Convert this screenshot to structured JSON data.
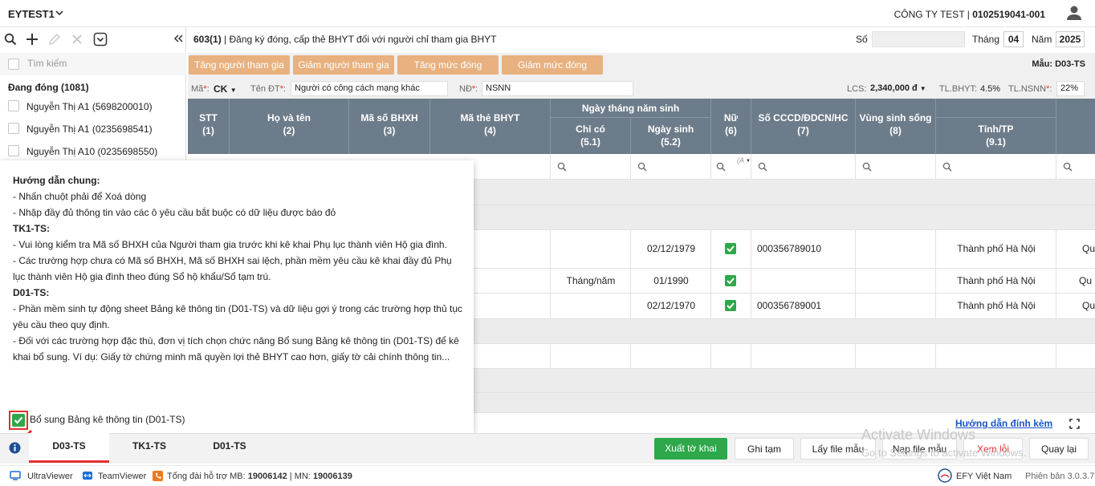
{
  "topbar": {
    "app_title": "EYTEST1",
    "company_name": "CÔNG TY TEST",
    "tax_code": "0102519041-001"
  },
  "sidebar": {
    "search_placeholder": "Tìm kiếm",
    "group_title": "Đang đóng (1081)",
    "items": [
      {
        "label": "Nguyễn Thị A1 (5698200010)"
      },
      {
        "label": "Nguyễn Thị A1 (0235698541)"
      },
      {
        "label": "Nguyễn Thị A10 (0235698550)"
      }
    ]
  },
  "header": {
    "form_code": "603(1)",
    "form_title": " | Đăng ký đóng, cấp thẻ BHYT đối với người chỉ tham gia BHYT",
    "so_label": "Số",
    "so_value": "",
    "thang_label": "Tháng",
    "thang_value": "04",
    "nam_label": "Năm",
    "nam_value": "2025"
  },
  "actions": {
    "buttons": [
      "Tăng người tham gia",
      "Giảm người tham gia",
      "Tăng mức đóng",
      "Giảm mức đóng"
    ],
    "mau": "Mẫu: D03-TS"
  },
  "fields": {
    "ma_label": "Mã",
    "ma_value": "CK",
    "tendt_label": "Tên ĐT",
    "tendt_value": "Người có công cách mạng khác",
    "nd_label": "NĐ",
    "nd_value": "NSNN",
    "lcs_label": "LCS:",
    "lcs_value": "2,340,000 đ",
    "tlbhyt_label": "TL.BHYT:",
    "tlbhyt_value": "4.5%",
    "tlnsnn_label": "TL.NSNN",
    "tlnsnn_value": "22%"
  },
  "table": {
    "group_header": "Ngày tháng năm sinh",
    "columns": [
      {
        "label": "STT",
        "num": "(1)"
      },
      {
        "label": "Họ và tên",
        "num": "(2)"
      },
      {
        "label": "Mã số BHXH",
        "num": "(3)"
      },
      {
        "label": "Mã thẻ BHYT",
        "num": "(4)"
      },
      {
        "label": "Chỉ có",
        "num": "(5.1)"
      },
      {
        "label": "Ngày sinh",
        "num": "(5.2)"
      },
      {
        "label": "Nữ",
        "num": "(6)"
      },
      {
        "label": "Số CCCD/ĐDCN/HC",
        "num": "(7)"
      },
      {
        "label": "Vùng sinh sống",
        "num": "(8)"
      },
      {
        "label": "Tỉnh/TP",
        "num": "(9.1)"
      }
    ],
    "filter_hint": "(A",
    "rows": [
      {
        "chi_co": "",
        "ngay_sinh": "02/12/1979",
        "nu": true,
        "cccd": "000356789010",
        "tinh": "Thành phố Hà Nội",
        "next": "Qu"
      },
      {
        "chi_co": "Tháng/năm",
        "ngay_sinh": "01/1990",
        "nu": true,
        "cccd": "",
        "tinh": "Thành phố Hà Nội",
        "next": "Qu"
      },
      {
        "chi_co": "",
        "ngay_sinh": "02/12/1970",
        "nu": true,
        "cccd": "000356789001",
        "tinh": "Thành phố Hà Nội",
        "next": "Qu"
      }
    ]
  },
  "guide": {
    "lines": [
      {
        "text": "Hướng dẫn chung:",
        "bold": true
      },
      {
        "text": "- Nhấn chuột phải để Xoá dòng"
      },
      {
        "text": "- Nhập đầy đủ thông tin vào các ô yêu cầu bắt buộc có dữ liệu được báo đỏ"
      },
      {
        "text": "TK1-TS:",
        "bold": true
      },
      {
        "text": "- Vui lòng kiểm tra Mã số BHXH của Người tham gia trước khi kê khai Phụ lục thành viên Hộ gia đình."
      },
      {
        "text": "- Các trường hợp chưa có Mã số BHXH, Mã số BHXH sai lệch, phần mềm yêu cầu kê khai đầy đủ Phụ"
      },
      {
        "text": "lục thành viên Hộ gia đình theo đúng Sổ hộ khẩu/Sổ tạm trú."
      },
      {
        "text": "D01-TS:",
        "bold": true
      },
      {
        "text": "- Phần mềm sinh tự động sheet Bảng kê thông tin (D01-TS) và dữ liệu gợi ý trong các trường hợp thủ tục"
      },
      {
        "text": "yêu cầu theo quy định."
      },
      {
        "text": "- Đối với các trường hợp đặc thù, đơn vị tích chọn chức năng Bổ sung Bảng kê thông tin (D01-TS) để kê"
      },
      {
        "text": "khai bổ sung. Ví dụ: Giấy tờ chứng minh mã quyền lợi thẻ BHYT cao hơn, giấy tờ cải chính thông tin..."
      }
    ],
    "checkbox_label": "Bổ sung Bảng kê thông tin (D01-TS)",
    "checkbox_checked": true
  },
  "guide_link": "Hướng dẫn đính kèm",
  "tabs": [
    "D03-TS",
    "TK1-TS",
    "D01-TS"
  ],
  "bottom_buttons": {
    "xuat": "Xuất tờ khai",
    "ghitam": "Ghi tạm",
    "layfile": "Lấy file mẫu",
    "napfile": "Nạp file mẫu",
    "xemloi": "Xem lỗi",
    "quaylai": "Quay lại"
  },
  "watermark": {
    "line1": "Activate Windows",
    "line2": "Go to Settings to activate Windows."
  },
  "statusbar": {
    "ultraviewer": "UltraViewer",
    "teamviewer": "TeamViewer",
    "hotline_prefix": "Tổng đài hỗ trợ MB: ",
    "hotline_mb": "19006142",
    "hotline_sep": " | MN: ",
    "hotline_mn": "19006139",
    "brand": "EFY Việt Nam",
    "version": "Phiên bản 3.0.3.7"
  },
  "colors": {
    "accent_orange": "#e8b17f",
    "header_gray": "#6d7c8a",
    "green": "#2ea84a",
    "link_blue": "#1a56c4",
    "red": "#e03030"
  }
}
